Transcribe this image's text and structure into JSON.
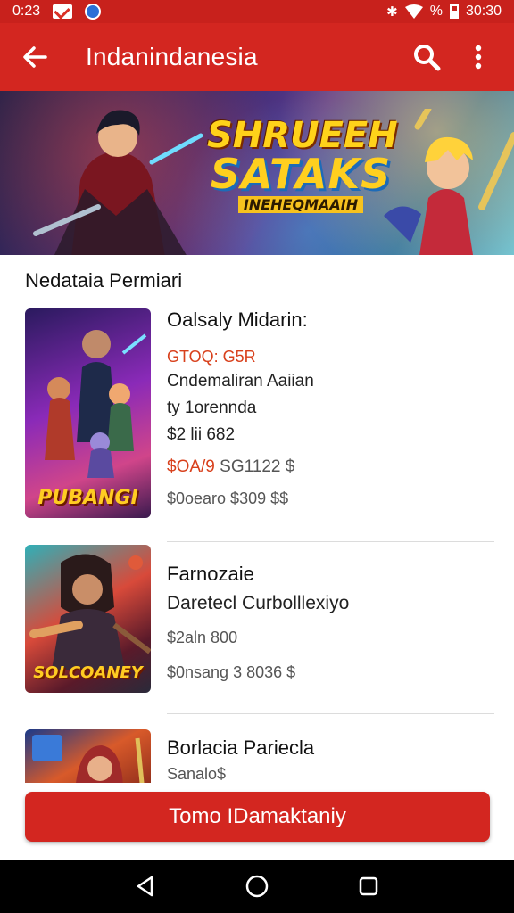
{
  "status_bar": {
    "time": "0:23",
    "battery_text": "%",
    "clock_right": "30:30",
    "icons": [
      "gmail-icon",
      "app-notification-icon",
      "bluetooth-icon",
      "wifi-icon",
      "battery-icon"
    ]
  },
  "app_bar": {
    "title": "Indanindanesia",
    "icons": [
      "back-arrow-icon",
      "search-icon",
      "more-vert-icon"
    ]
  },
  "banner": {
    "logo_line1": "SHRUEEH",
    "logo_line2": "SATAKS",
    "logo_line3": "INEHEQMAAIH"
  },
  "section": {
    "title": "Nedataia Permiari"
  },
  "games": [
    {
      "thumb_caption": "PUBANGI",
      "title": "Oalsaly Midarin:",
      "red_line": "GTOQ: G5R",
      "line1": "Cndemaliran Aaiian",
      "line2": "ty 1orennda",
      "line3": "$2 lii 682",
      "price_red": "$OA/9",
      "price_rest": "SG1122 $",
      "price_gray": "$0oearo $309 $$"
    },
    {
      "thumb_caption": "SOLCOANEY",
      "title": "Farnozaie",
      "line1": "Daretecl Curbolllexiyo",
      "line2": "$2aln 800",
      "price_gray": "$0nsang 3 8036 $"
    },
    {
      "title": "Borlacia Pariecla",
      "line1": "Sanalo$"
    }
  ],
  "cta": {
    "label": "Tomo IDamaktaniy"
  },
  "nav_bar": {
    "icons": [
      "back-triangle-icon",
      "home-circle-icon",
      "recents-square-icon"
    ]
  },
  "colors": {
    "primary": "#d32620",
    "status_bar": "#c8211c",
    "accent_red_text": "#d8401c"
  }
}
